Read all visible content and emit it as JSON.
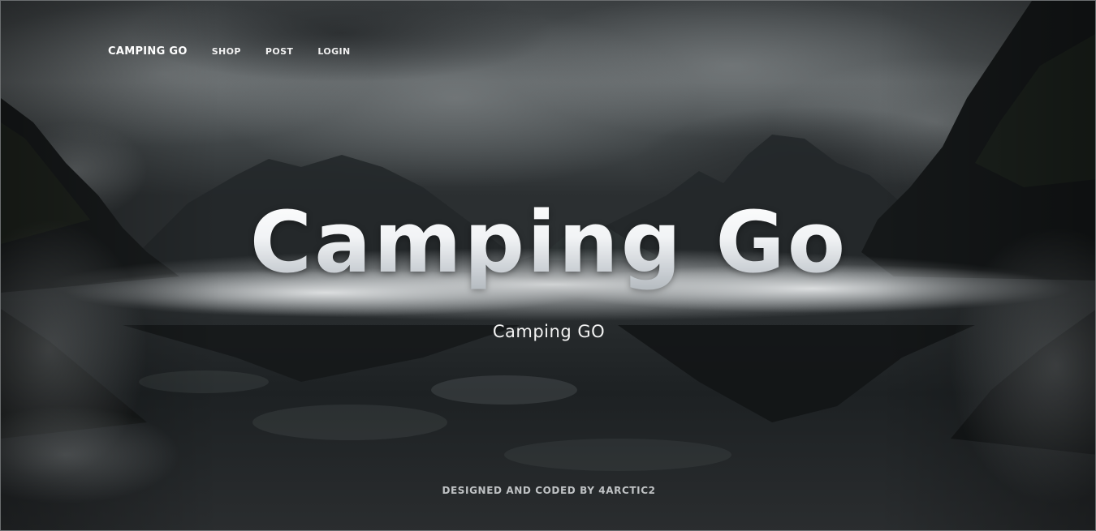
{
  "nav": {
    "brand": "CAMPING GO",
    "links": [
      {
        "label": "SHOP"
      },
      {
        "label": "POST"
      },
      {
        "label": "LOGIN"
      }
    ]
  },
  "hero": {
    "title": "Camping Go",
    "subtitle": "Camping GO"
  },
  "footer": {
    "credit": "DESIGNED AND CODED BY 4ARCTIC2"
  },
  "colors": {
    "text": "#ffffff",
    "sky": "#5f6466",
    "water": "#1b1e20",
    "mist": "#e6e8ea"
  }
}
